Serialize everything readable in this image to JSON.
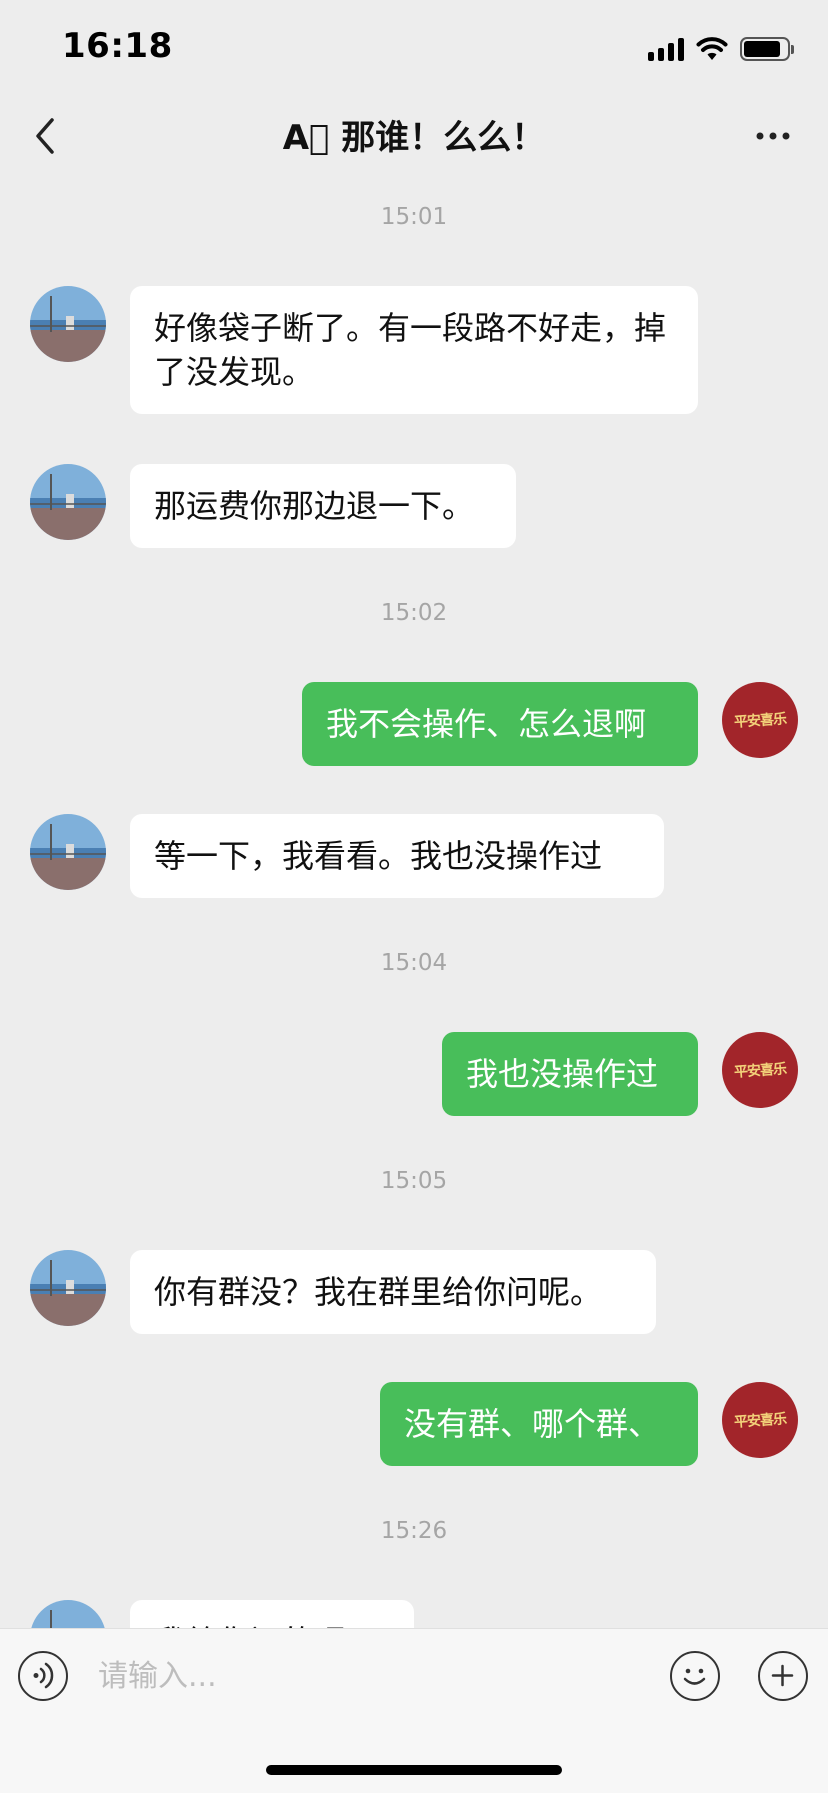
{
  "status_bar": {
    "time": "16:18"
  },
  "nav": {
    "title": "A⃞ 那谁！么么！"
  },
  "messages": [
    {
      "type": "time",
      "text": "15:01"
    },
    {
      "type": "in",
      "text": "好像袋子断了。有一段路不好走，掉了没发现。"
    },
    {
      "type": "in",
      "text": "那运费你那边退一下。"
    },
    {
      "type": "time",
      "text": "15:02"
    },
    {
      "type": "out",
      "text": "我不会操作、怎么退啊"
    },
    {
      "type": "in",
      "text": "等一下，我看看。我也没操作过"
    },
    {
      "type": "time",
      "text": "15:04"
    },
    {
      "type": "out",
      "text": "我也没操作过"
    },
    {
      "type": "time",
      "text": "15:05"
    },
    {
      "type": "in",
      "text": "你有群没？我在群里给你问呢。"
    },
    {
      "type": "out",
      "text": "没有群、哪个群、"
    },
    {
      "type": "time",
      "text": "15:26"
    },
    {
      "type": "in",
      "text": "我给你问的呢。"
    }
  ],
  "my_avatar": {
    "seal_text": "平安喜乐"
  },
  "input": {
    "placeholder": "请输入..."
  },
  "colors": {
    "background": "#ededed",
    "outgoing_bubble": "#48be5a",
    "incoming_bubble": "#ffffff",
    "avatar_red": "#a2252a"
  }
}
